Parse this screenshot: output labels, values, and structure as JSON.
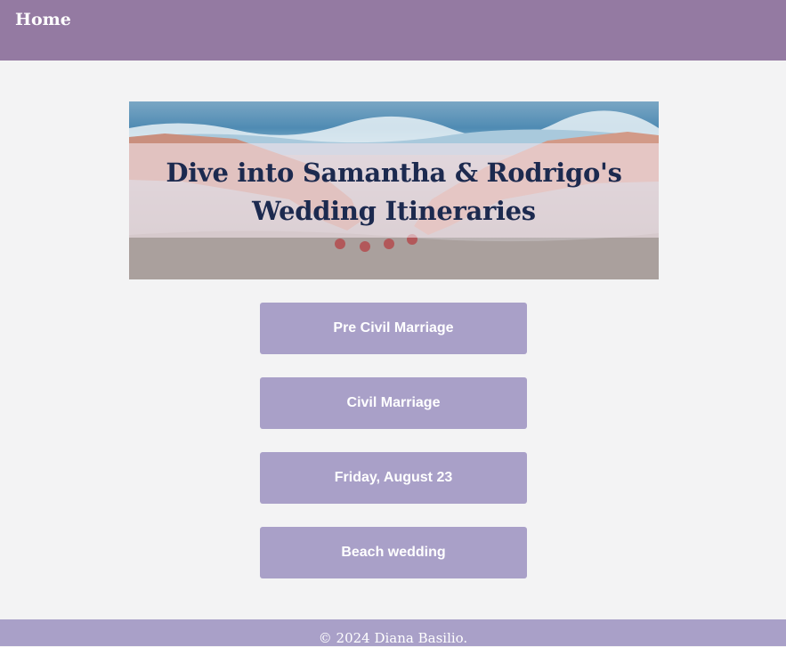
{
  "nav": {
    "home_label": "Home"
  },
  "hero": {
    "title_line1": "Dive into Samantha & Rodrigo's",
    "title_line2": "Wedding Itineraries"
  },
  "itinerary_buttons": [
    {
      "label": "Pre Civil Marriage"
    },
    {
      "label": "Civil Marriage"
    },
    {
      "label": "Friday, August 23"
    },
    {
      "label": "Beach wedding"
    }
  ],
  "footer": {
    "text": "© 2024 Diana Basilio."
  },
  "colors": {
    "nav_bg": "#947aa2",
    "button_bg": "#a9a0c8",
    "footer_bg": "#a9a0c8",
    "page_bg": "#f3f3f4",
    "title_color": "#1c2a4f"
  }
}
